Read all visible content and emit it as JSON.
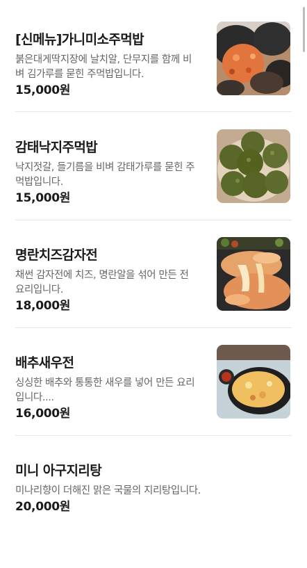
{
  "menu_items": [
    {
      "name": "[신메뉴]가니미소주먹밥",
      "description": "붉은대게딱지장에 날치알, 단무지를 함께 비벼 김가루를 묻힌 주먹밥입니다.",
      "price": "15,000원",
      "image": "crab-rice-ball-photo"
    },
    {
      "name": "감태낙지주먹밥",
      "description": "낙지젓갈, 들기름을 비벼 감태가루를 묻힌 주먹밥입니다.",
      "price": "15,000원",
      "image": "seaweed-rice-balls-photo"
    },
    {
      "name": "명란치즈감자전",
      "description": "채썬 감자전에 치즈, 명란알을 섞어 만든 전 요리입니다.",
      "price": "18,000원",
      "image": "potato-pancake-cheese-photo"
    },
    {
      "name": "배추새우전",
      "description": "싱싱한 배추와 통통한 새우를 넣어 만든 요리입니다....",
      "price": "16,000원",
      "image": "cabbage-shrimp-pancake-photo"
    },
    {
      "name": "미니 아구지리탕",
      "description": "미나리향이 더해진 맑은 국물의 지리탕입니다.",
      "price": "20,000원"
    }
  ]
}
